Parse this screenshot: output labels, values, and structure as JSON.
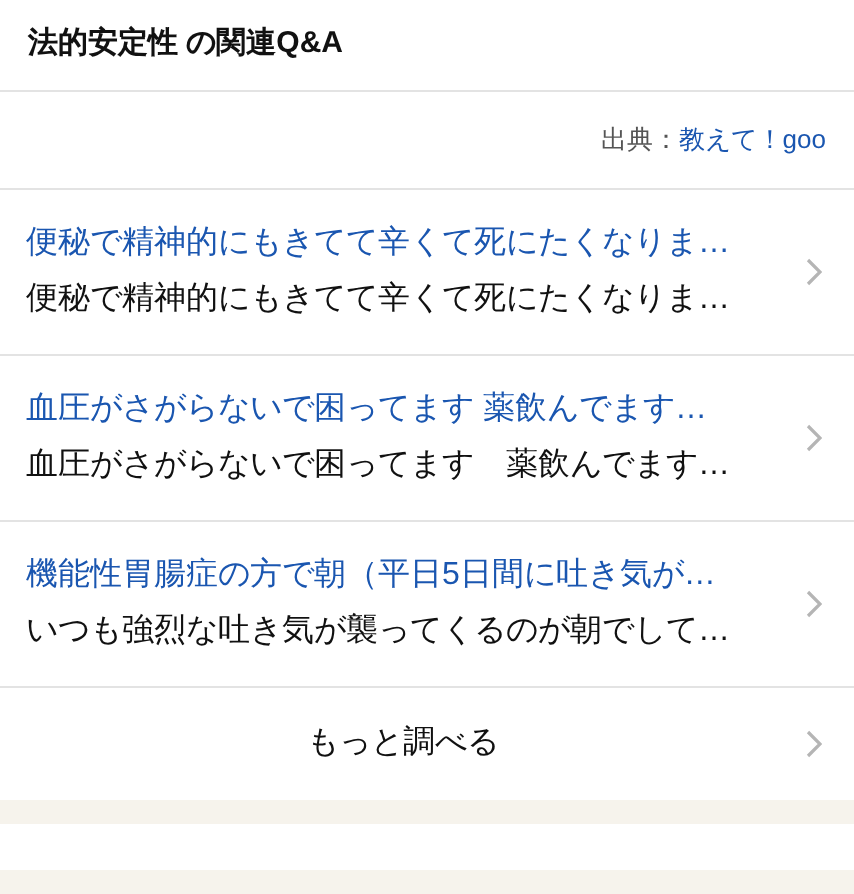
{
  "heading": "法的安定性 の関連Q&A",
  "source": {
    "label": "出典：",
    "link": "教えて！goo"
  },
  "questions": [
    {
      "title": "便秘で精神的にもきてて辛くて死にたくなりま…",
      "excerpt": "便秘で精神的にもきてて辛くて死にたくなりま…"
    },
    {
      "title": "血圧がさがらないで困ってます 薬飲んでます…",
      "excerpt": "血圧がさがらないで困ってます　薬飲んでます…"
    },
    {
      "title": "機能性胃腸症の方で朝（平日5日間に吐き気が…",
      "excerpt": "いつも強烈な吐き気が襲ってくるのが朝でして…"
    }
  ],
  "more": "もっと調べる"
}
